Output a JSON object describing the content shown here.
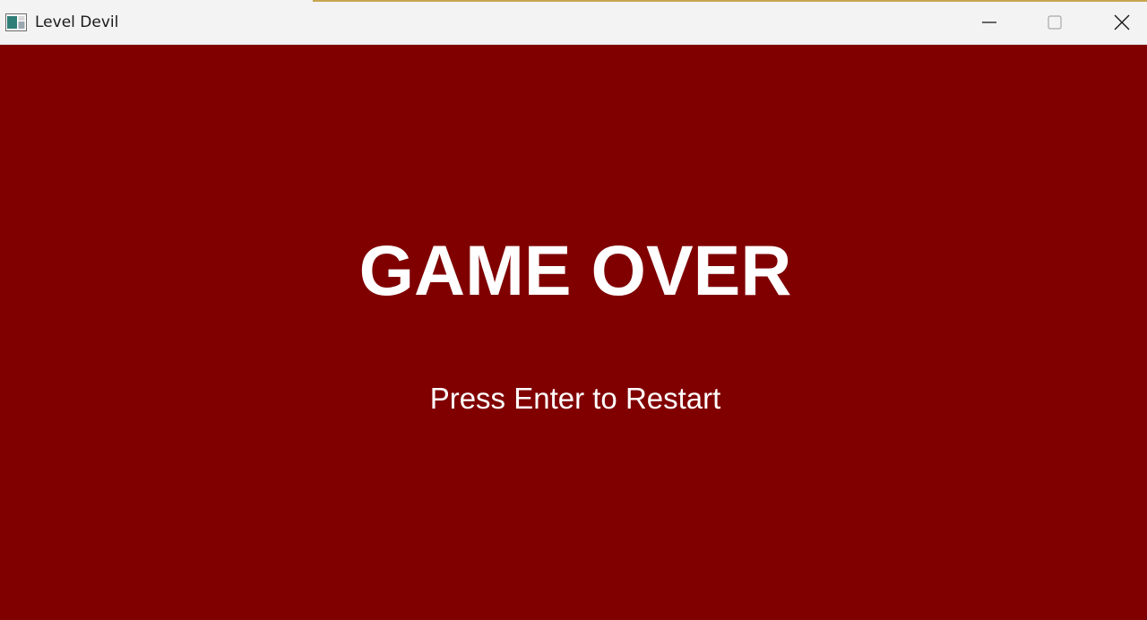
{
  "window": {
    "title": "Level Devil",
    "icon": "app-window-icon",
    "controls": [
      "minimize-icon",
      "maximize-icon",
      "close-icon"
    ]
  },
  "game": {
    "heading": "GAME OVER",
    "prompt": "Press Enter to Restart",
    "background_color": "#800000",
    "text_color": "#ffffff"
  }
}
